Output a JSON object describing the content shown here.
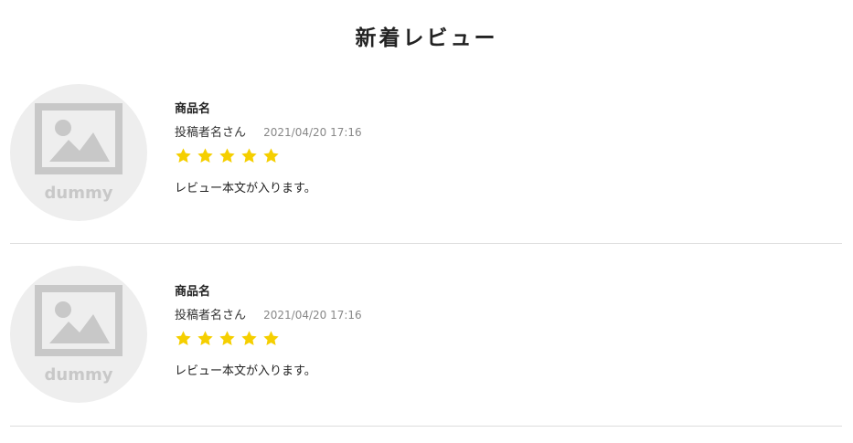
{
  "page": {
    "title": "新着レビュー"
  },
  "reviews": [
    {
      "product_name": "商品名",
      "author": "投稿者名さん",
      "date": "2021/04/20 17:16",
      "rating": 5,
      "rating_max": 5,
      "text": "レビュー本文が入ります。",
      "thumbnail": {
        "icon": "image-placeholder-icon",
        "label": "dummy"
      }
    },
    {
      "product_name": "商品名",
      "author": "投稿者名さん",
      "date": "2021/04/20 17:16",
      "rating": 5,
      "rating_max": 5,
      "text": "レビュー本文が入ります。",
      "thumbnail": {
        "icon": "image-placeholder-icon",
        "label": "dummy"
      }
    }
  ],
  "colors": {
    "star": "#f5cf00",
    "placeholder_bg": "#eeeeee",
    "placeholder_fg": "#c8c8c8",
    "divider": "#dddddd"
  }
}
